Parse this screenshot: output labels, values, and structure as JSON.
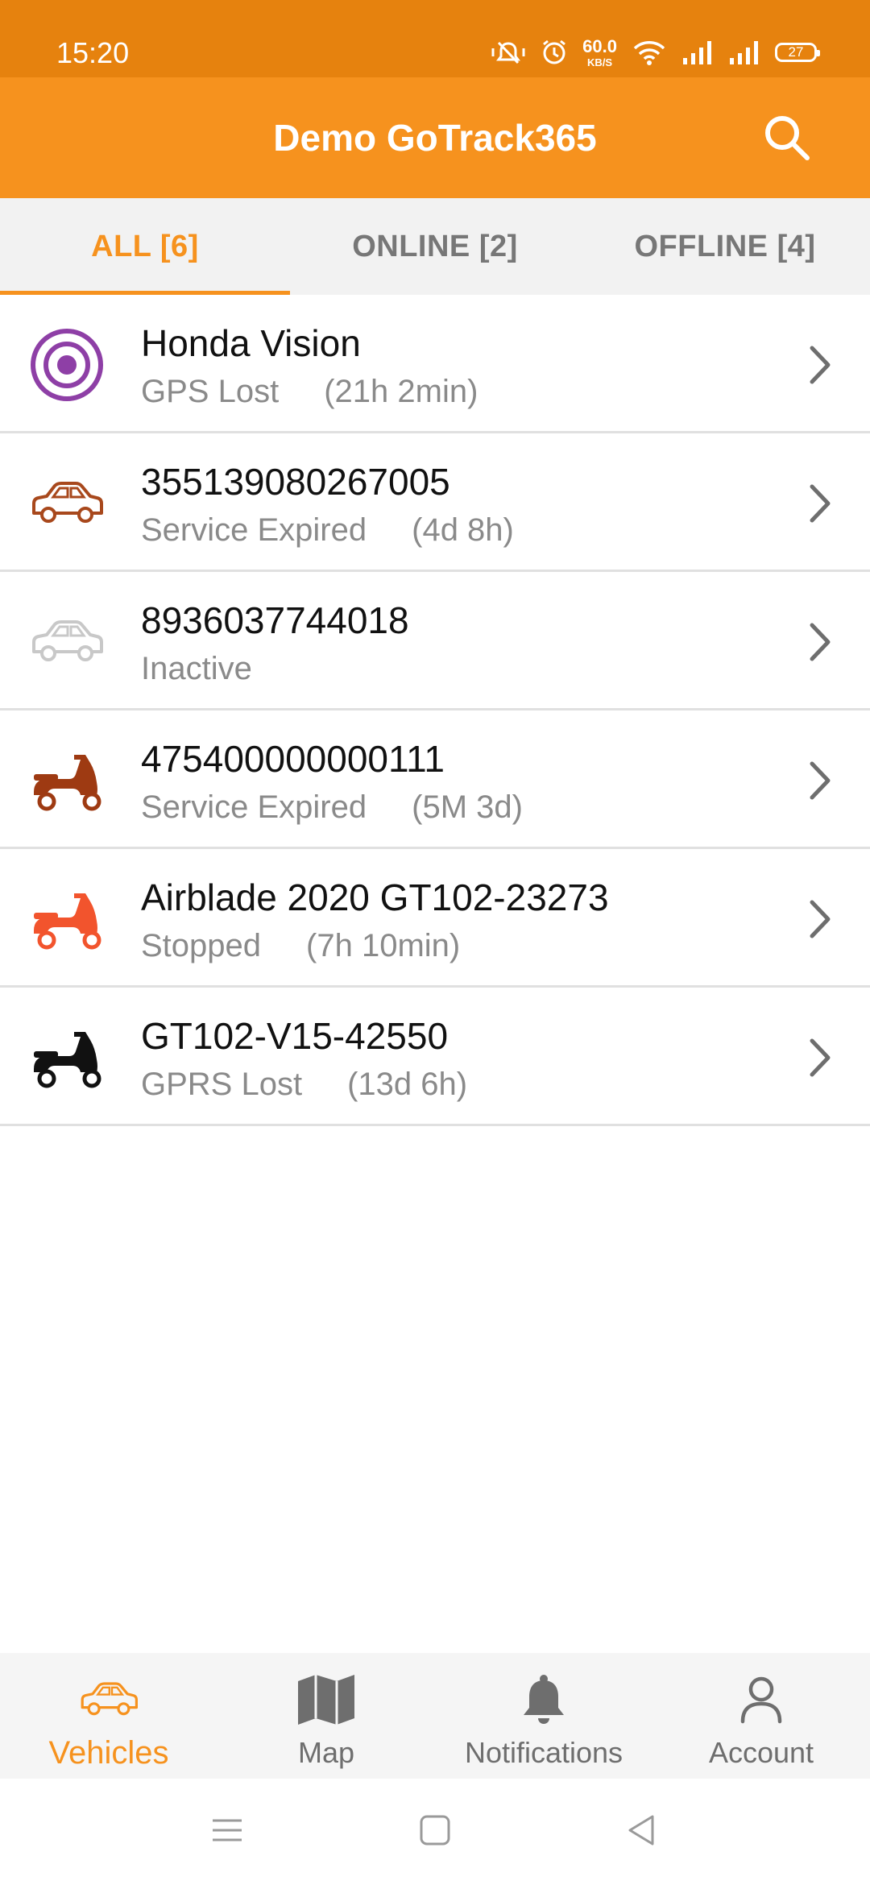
{
  "status_bar": {
    "time": "15:20",
    "net_speed_value": "60.0",
    "net_speed_unit": "KB/S",
    "battery": "27"
  },
  "app_bar": {
    "title": "Demo GoTrack365"
  },
  "tabs": [
    {
      "label": "ALL [6]",
      "active": true
    },
    {
      "label": "ONLINE [2]",
      "active": false
    },
    {
      "label": "OFFLINE [4]",
      "active": false
    }
  ],
  "vehicles": [
    {
      "name": "Honda Vision",
      "status": "GPS Lost",
      "duration": "(21h 2min)",
      "icon": "gps-target-icon",
      "color": "#8E3FA6"
    },
    {
      "name": "355139080267005",
      "status": "Service Expired",
      "duration": "(4d 8h)",
      "icon": "car-icon",
      "color": "#A8481C"
    },
    {
      "name": "8936037744018",
      "status": "Inactive",
      "duration": "",
      "icon": "car-icon",
      "color": "#C8C8C8"
    },
    {
      "name": "475400000000111",
      "status": "Service Expired",
      "duration": "(5M 3d)",
      "icon": "scooter-icon",
      "color": "#9E3A12"
    },
    {
      "name": "Airblade 2020 GT102-23273",
      "status": "Stopped",
      "duration": "(7h 10min)",
      "icon": "scooter-icon",
      "color": "#F2542D"
    },
    {
      "name": "GT102-V15-42550",
      "status": "GPRS Lost",
      "duration": "(13d 6h)",
      "icon": "scooter-icon",
      "color": "#111111"
    }
  ],
  "bottom_nav": [
    {
      "label": "Vehicles",
      "icon": "car-icon",
      "active": true
    },
    {
      "label": "Map",
      "icon": "map-icon",
      "active": false
    },
    {
      "label": "Notifications",
      "icon": "bell-icon",
      "active": false
    },
    {
      "label": "Account",
      "icon": "person-icon",
      "active": false
    }
  ],
  "colors": {
    "status_bar": "#E6820E",
    "app_bar": "#F6921E",
    "accent": "#F6921E"
  }
}
